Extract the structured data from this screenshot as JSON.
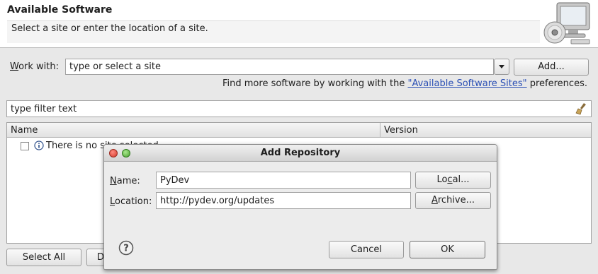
{
  "header": {
    "title": "Available Software",
    "description": "Select a site or enter the location of a site."
  },
  "work_with": {
    "label": "Work with:",
    "placeholder": "type or select a site",
    "add_button": "Add...",
    "find_more_prefix": "Find more software by working with the ",
    "find_more_link": "\"Available Software Sites\"",
    "find_more_suffix": " preferences."
  },
  "filter": {
    "placeholder": "type filter text"
  },
  "table": {
    "columns": [
      "Name",
      "Version"
    ],
    "rows": [
      {
        "text": "There is no site selected."
      }
    ]
  },
  "bottom_buttons": {
    "select_all": "Select All",
    "deselect_all": "Deselect All"
  },
  "dialog": {
    "title": "Add Repository",
    "name_label": "Name:",
    "name_value": "PyDev",
    "location_label": "Location:",
    "location_value": "http://pydev.org/updates",
    "local_button": "Local...",
    "archive_button": "Archive...",
    "cancel_button": "Cancel",
    "ok_button": "OK"
  }
}
